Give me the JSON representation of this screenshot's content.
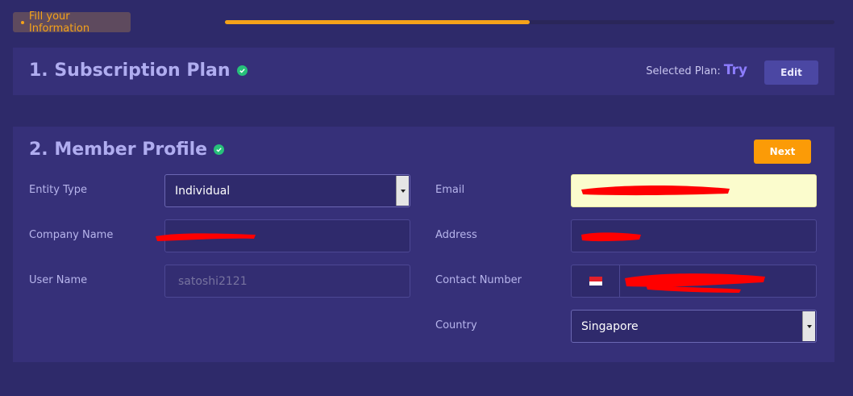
{
  "header": {
    "step_label": "Fill your Information",
    "progress_fraction": 0.5
  },
  "subscription": {
    "title": "1. Subscription Plan",
    "selected_label": "Selected Plan:",
    "plan_name": "Try",
    "edit_label": "Edit"
  },
  "profile": {
    "title": "2. Member Profile",
    "next_label": "Next",
    "fields": {
      "entity_type": {
        "label": "Entity Type",
        "value": "Individual"
      },
      "company_name": {
        "label": "Company Name"
      },
      "user_name": {
        "label": "User Name",
        "value": "satoshi2121"
      },
      "email": {
        "label": "Email"
      },
      "address": {
        "label": "Address"
      },
      "contact_number": {
        "label": "Contact Number",
        "flag": "singapore-flag"
      },
      "country": {
        "label": "Country",
        "value": "Singapore"
      }
    }
  },
  "colors": {
    "background": "#2e2a6a",
    "panel": "#363079",
    "accent": "#f5a21a",
    "next_button": "#fb9b07",
    "success": "#27c07a",
    "plan_name": "#8d7dff",
    "redaction": "#ff0000"
  }
}
